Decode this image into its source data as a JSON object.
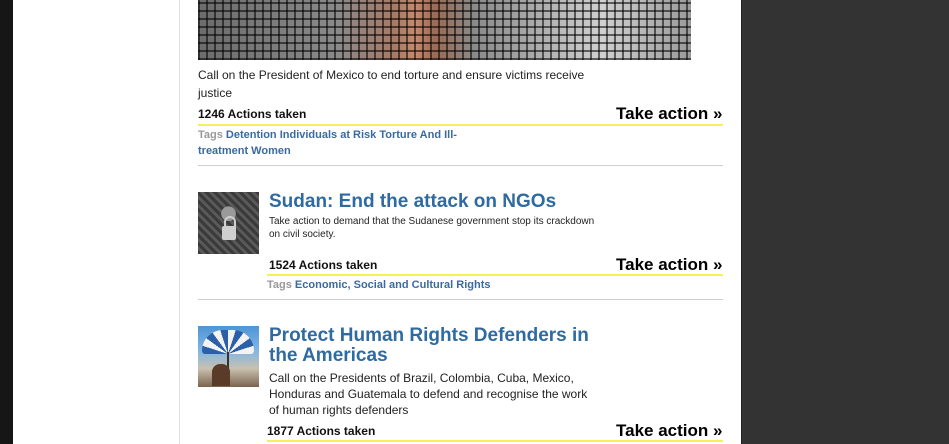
{
  "colors": {
    "link": "#2f6aa1",
    "tag_link": "#3a6aa0",
    "underline": "#f6ef5a",
    "right_panel": "#333333",
    "left_border": "#161616"
  },
  "items": [
    {
      "description": "Call on the President of Mexico to end torture and ensure victims receive justice",
      "actions_taken": "1246 Actions taken",
      "take_action_label": "Take action »",
      "tags_label": "Tags",
      "tags": [
        "Detention Individuals at Risk Torture And Ill-treatment Women"
      ]
    },
    {
      "title": "Sudan: End the attack on NGOs",
      "description": "Take action to demand that the Sudanese government stop its crackdown on civil society.",
      "thumbnail": "padlock-on-chain-image",
      "actions_taken": "1524 Actions taken",
      "take_action_label": "Take action »",
      "tags_label": "Tags",
      "tags": [
        "Economic, Social and Cultural Rights"
      ]
    },
    {
      "title": "Protect Human Rights Defenders in the Americas",
      "description": "Call on the Presidents of Brazil, Colombia, Cuba, Mexico, Honduras and Guatemala to defend and recognise the work of human rights defenders",
      "thumbnail": "person-under-umbrella-image",
      "actions_taken": "1877 Actions taken",
      "take_action_label": "Take action »"
    }
  ]
}
